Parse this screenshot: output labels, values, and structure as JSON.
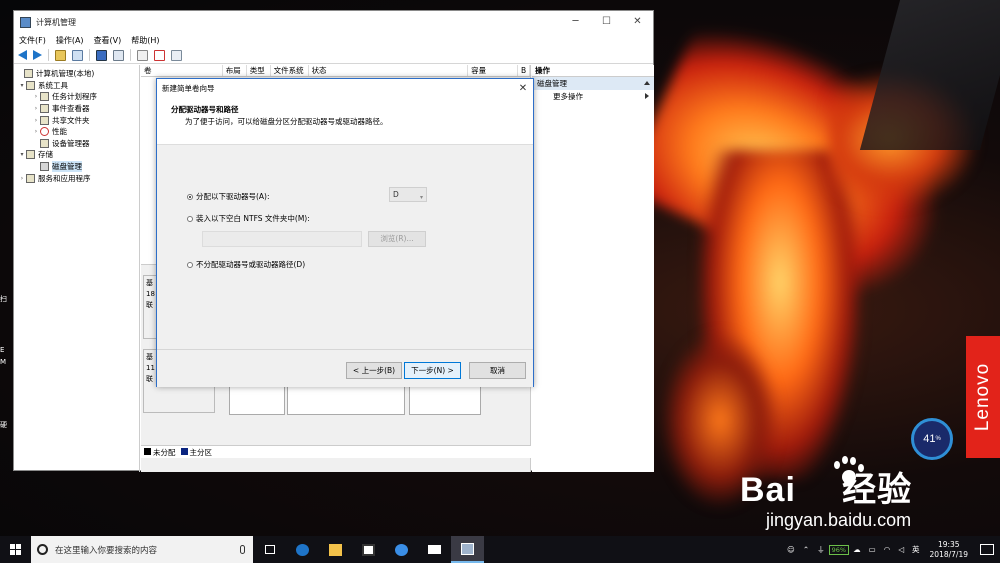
{
  "window": {
    "title": "计算机管理",
    "controls": {
      "minimize": "─",
      "maximize": "☐",
      "close": "✕"
    }
  },
  "menu": [
    "文件(F)",
    "操作(A)",
    "查看(V)",
    "帮助(H)"
  ],
  "tree": [
    {
      "label": "计算机管理(本地)",
      "indent": 0,
      "twisty": ""
    },
    {
      "label": "系统工具",
      "indent": 1,
      "twisty": "▾"
    },
    {
      "label": "任务计划程序",
      "indent": 2,
      "twisty": "›"
    },
    {
      "label": "事件查看器",
      "indent": 2,
      "twisty": "›"
    },
    {
      "label": "共享文件夹",
      "indent": 2,
      "twisty": "›"
    },
    {
      "label": "性能",
      "indent": 2,
      "twisty": "›"
    },
    {
      "label": "设备管理器",
      "indent": 2,
      "twisty": ""
    },
    {
      "label": "存储",
      "indent": 1,
      "twisty": "▾"
    },
    {
      "label": "磁盘管理",
      "indent": 2,
      "twisty": "",
      "selected": true
    },
    {
      "label": "服务和应用程序",
      "indent": 1,
      "twisty": "›"
    }
  ],
  "columns": [
    "卷",
    "布局",
    "类型",
    "文件系统",
    "状态",
    "容量",
    "B"
  ],
  "disks": [
    {
      "l1": "基",
      "l2": "18",
      "l3": "联"
    },
    {
      "l1": "基",
      "l2": "11",
      "l3": "联"
    }
  ],
  "legend": {
    "unallocated": "未分配",
    "primary": "主分区",
    "unallocated_color": "#000000",
    "primary_color": "#0a2480"
  },
  "actions": {
    "header": "操作",
    "section": "磁盘管理",
    "more": "更多操作"
  },
  "wizard": {
    "title": "新建简单卷向导",
    "close": "✕",
    "heading": "分配驱动器号和路径",
    "subheading": "为了便于访问，可以给磁盘分区分配驱动器号或驱动器路径。",
    "option_assign": "分配以下驱动器号(A):",
    "drive_letter": "D",
    "option_mount": "装入以下空白 NTFS 文件夹中(M):",
    "browse": "浏览(R)...",
    "option_none": "不分配驱动器号或驱动器路径(D)",
    "btn_back": "< 上一步(B)",
    "btn_next": "下一步(N) >",
    "btn_cancel": "取消"
  },
  "desktop": {
    "brand": "Lenovo",
    "meter_value": "41",
    "meter_unit": "%",
    "left_labels": [
      "扫",
      "E",
      "M",
      "硬"
    ]
  },
  "watermark": {
    "logo_left": "Bai",
    "logo_right": "经验",
    "url": "jingyan.baidu.com"
  },
  "taskbar": {
    "search_placeholder": "在这里输入你要搜索的内容",
    "battery": "96%",
    "ime": "英",
    "time": "19:35",
    "date": "2018/7/19"
  },
  "colors": {
    "accent": "#0078d7",
    "lenovo_red": "#e2231a",
    "edge_blue": "#1e74c8"
  }
}
